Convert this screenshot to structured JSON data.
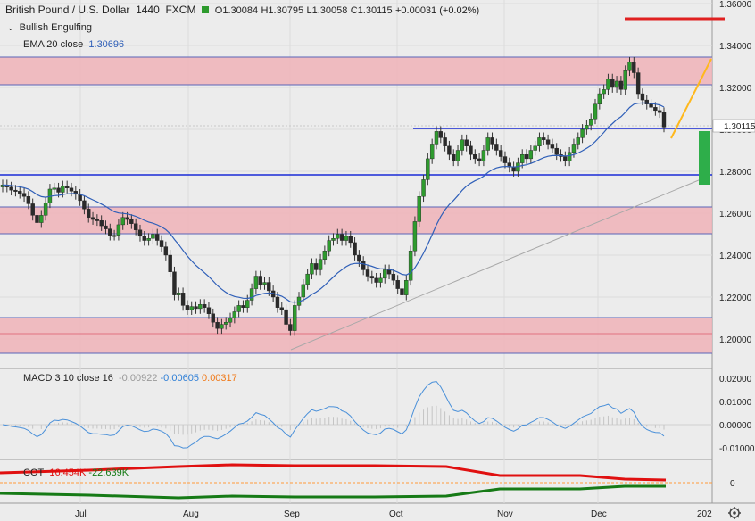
{
  "header": {
    "symbol": "British Pound / U.S. Dollar",
    "interval": "1440",
    "exchange": "FXCM",
    "ohlc": {
      "open": "O1.30084",
      "high": "H1.30795",
      "low": "L1.30058",
      "close": "C1.30115",
      "change": "+0.00031 (+0.02%)"
    }
  },
  "indicators": {
    "pattern": "Bullish Engulfing",
    "ema": {
      "label": "EMA 20 close",
      "value": "1.30696"
    },
    "macd": {
      "label": "MACD 3 10 close 16",
      "v1": "-0.00922",
      "v2": "-0.00605",
      "v3": "0.00317"
    },
    "cot": {
      "label": "COT",
      "v1": "16.454K",
      "v2": "-22.639K"
    }
  },
  "price_axis": {
    "ticks": [
      "1.36000",
      "1.34000",
      "1.32000",
      "1.30000",
      "1.28000",
      "1.26000",
      "1.24000",
      "1.22000",
      "1.20000"
    ],
    "current_price": "1.30115"
  },
  "macd_axis": {
    "ticks": [
      "0.02000",
      "0.01000",
      "0.00000",
      "-0.01000"
    ]
  },
  "cot_axis": {
    "ticks": [
      "0"
    ]
  },
  "time_axis": {
    "ticks": [
      "Jul",
      "Aug",
      "Sep",
      "Oct",
      "Nov",
      "Dec",
      "202"
    ]
  },
  "colors": {
    "up": "#2e9b2e",
    "down": "#2a2a2a",
    "ema": "#2f5fb8",
    "zone": "#f0b3b8",
    "hline": "#1a2bd6",
    "resistance": "#e02020",
    "macd": "#4a90d9",
    "cot_red": "#e01010",
    "cot_green": "#167a16",
    "arrow": "#ffb81c",
    "target": "#2eae4a"
  },
  "icons": {
    "collapse": "chevron-down-icon",
    "settings": "gear-icon"
  }
}
